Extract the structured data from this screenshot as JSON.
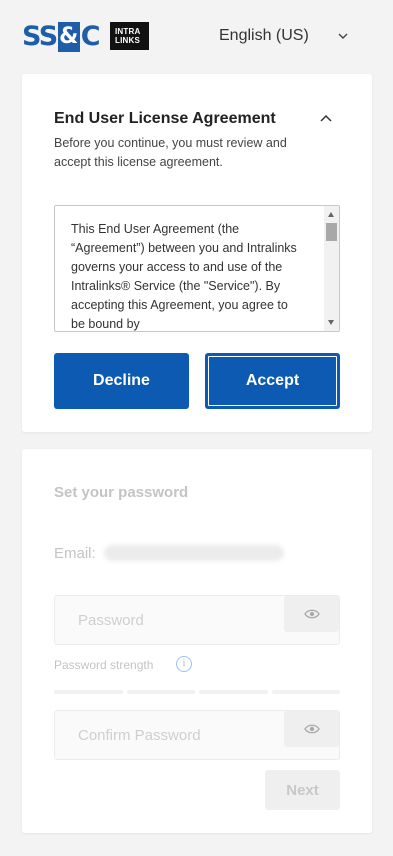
{
  "header": {
    "logo_ssc_left": "SS",
    "logo_ssc_amp": "&",
    "logo_ssc_right": "C",
    "logo_intralinks_line1": "INTRA",
    "logo_intralinks_line2": "LINKS",
    "language": "English (US)",
    "language_icon": "chevron-down-icon"
  },
  "eula": {
    "title": "End User License Agreement",
    "collapse_icon": "chevron-up-icon",
    "description": "Before you continue, you must review and accept this license agreement.",
    "agreement_text": "This End User Agreement (the “Agreement”) between you and Intralinks governs your access to and use of the Intralinks® Service (the \"Service\"). By accepting this Agreement, you agree to be bound by",
    "decline_label": "Decline",
    "accept_label": "Accept"
  },
  "password_form": {
    "title": "Set your password",
    "email_label": "Email:",
    "password_placeholder": "Password",
    "strength_label": "Password strength",
    "strength_info_glyph": "i",
    "confirm_placeholder": "Confirm Password",
    "show_password_icon": "eye-icon",
    "next_label": "Next"
  },
  "colors": {
    "brand_blue": "#1e5ea8",
    "button_blue": "#0d5ab2",
    "page_bg": "#f3f3f3"
  }
}
